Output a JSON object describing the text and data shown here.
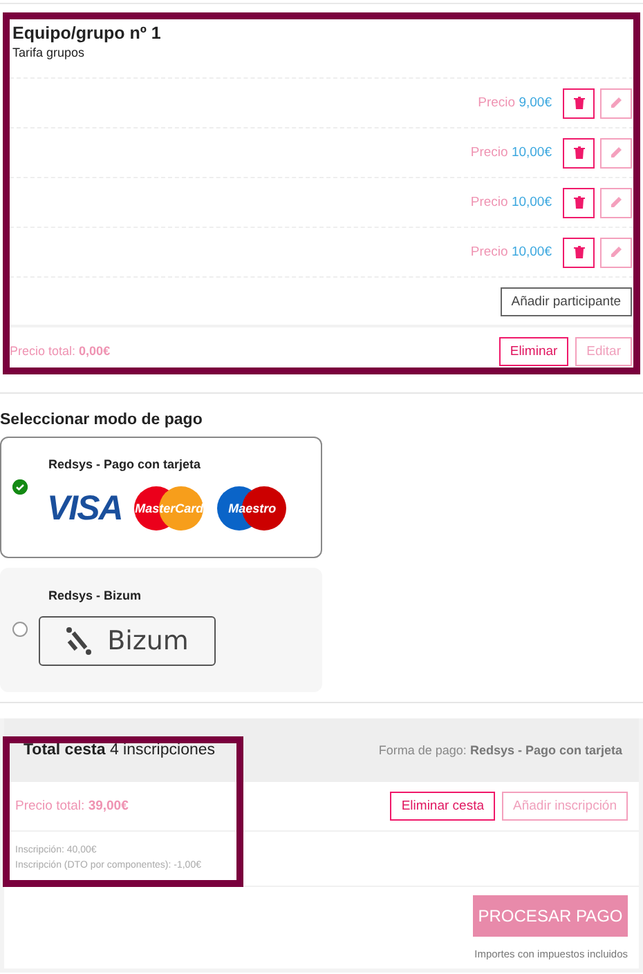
{
  "group": {
    "title": "Equipo/grupo nº 1",
    "subtitle": "Tarifa grupos",
    "participants": [
      {
        "price_label": "Precio",
        "price": "9,00€"
      },
      {
        "price_label": "Precio",
        "price": "10,00€"
      },
      {
        "price_label": "Precio",
        "price": "10,00€"
      },
      {
        "price_label": "Precio",
        "price": "10,00€"
      }
    ],
    "add_button": "Añadir participante",
    "total_label": "Precio total:",
    "total": "0,00€",
    "delete_button": "Eliminar",
    "edit_button": "Editar"
  },
  "payment": {
    "title": "Seleccionar modo de pago",
    "options": [
      {
        "name": "Redsys - Pago con tarjeta",
        "selected": true,
        "kind": "cards",
        "logos": [
          "VISA",
          "MasterCard",
          "Maestro"
        ]
      },
      {
        "name": "Redsys - Bizum",
        "selected": false,
        "kind": "bizum",
        "logos": [
          "Bizum"
        ]
      }
    ]
  },
  "basket": {
    "title": "Total cesta",
    "count": "4 inscripciones",
    "payment_label": "Forma de pago:",
    "payment_method": "Redsys - Pago con tarjeta",
    "total_label": "Precio total:",
    "total": "39,00€",
    "delete_button": "Eliminar cesta",
    "add_button": "Añadir inscripción",
    "breakdown": [
      "Inscripción: 40,00€",
      "Inscripción (DTO por componentes): -1,00€"
    ],
    "process_button": "PROCESAR PAGO",
    "tax_note": "Importes con impuestos incluidos"
  }
}
